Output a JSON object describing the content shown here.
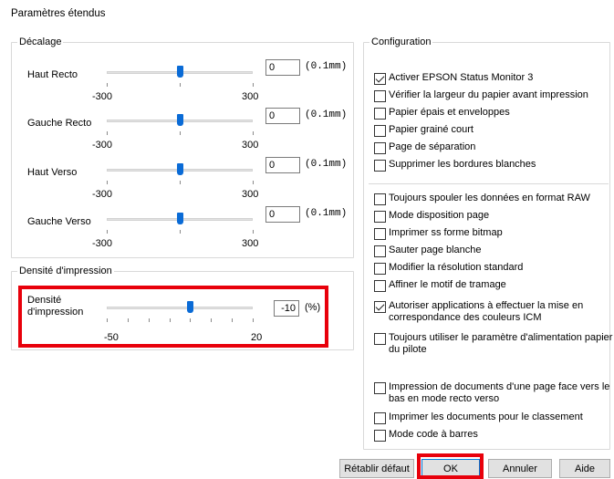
{
  "dialog": {
    "title": "Paramètres étendus"
  },
  "offset_group": {
    "legend": "Décalage",
    "rows": [
      {
        "label": "Haut Recto",
        "value": "0",
        "unit": "(0.1mm)",
        "min": "-300",
        "max": "300",
        "position": 0
      },
      {
        "label": "Gauche Recto",
        "value": "0",
        "unit": "(0.1mm)",
        "min": "-300",
        "max": "300",
        "position": 0
      },
      {
        "label": "Haut Verso",
        "value": "0",
        "unit": "(0.1mm)",
        "min": "-300",
        "max": "300",
        "position": 0
      },
      {
        "label": "Gauche Verso",
        "value": "0",
        "unit": "(0.1mm)",
        "min": "-300",
        "max": "300",
        "position": 0
      }
    ]
  },
  "density_group": {
    "legend": "Densité d'impression",
    "label_line1": "Densité",
    "label_line2": "d'impression",
    "value": "-10",
    "unit": "(%)",
    "min": "-50",
    "max": "20",
    "position": -10
  },
  "config_group": {
    "legend": "Configuration",
    "items": [
      {
        "label": "Activer EPSON Status Monitor 3",
        "checked": true
      },
      {
        "label": "Vérifier la largeur du papier avant impression",
        "checked": false
      },
      {
        "label": "Papier épais et enveloppes",
        "checked": false
      },
      {
        "label": "Papier grainé court",
        "checked": false
      },
      {
        "label": "Page de séparation",
        "checked": false
      },
      {
        "label": "Supprimer les bordures blanches",
        "checked": false
      },
      {
        "label": "Toujours spouler les données en format RAW",
        "checked": false
      },
      {
        "label": "Mode disposition page",
        "checked": false
      },
      {
        "label": "Imprimer ss forme bitmap",
        "checked": false
      },
      {
        "label": "Sauter page blanche",
        "checked": false
      },
      {
        "label": "Modifier la résolution standard",
        "checked": false
      },
      {
        "label": "Affiner le motif de tramage",
        "checked": false
      },
      {
        "label": "Autoriser applications à effectuer la mise en correspondance des couleurs ICM",
        "checked": true
      },
      {
        "label": "Toujours utiliser le paramètre d'alimentation papier du pilote",
        "checked": false
      },
      {
        "label": "Impression de documents d'une page face vers le bas en mode recto verso",
        "checked": false
      },
      {
        "label": "Imprimer les documents pour le classement",
        "checked": false
      },
      {
        "label": "Mode code à barres",
        "checked": false
      }
    ]
  },
  "buttons": {
    "reset": "Rétablir défaut",
    "ok": "OK",
    "cancel": "Annuler",
    "help": "Aide"
  },
  "colors": {
    "highlight": "#e8000b",
    "slider_thumb": "#0a6bd6"
  }
}
